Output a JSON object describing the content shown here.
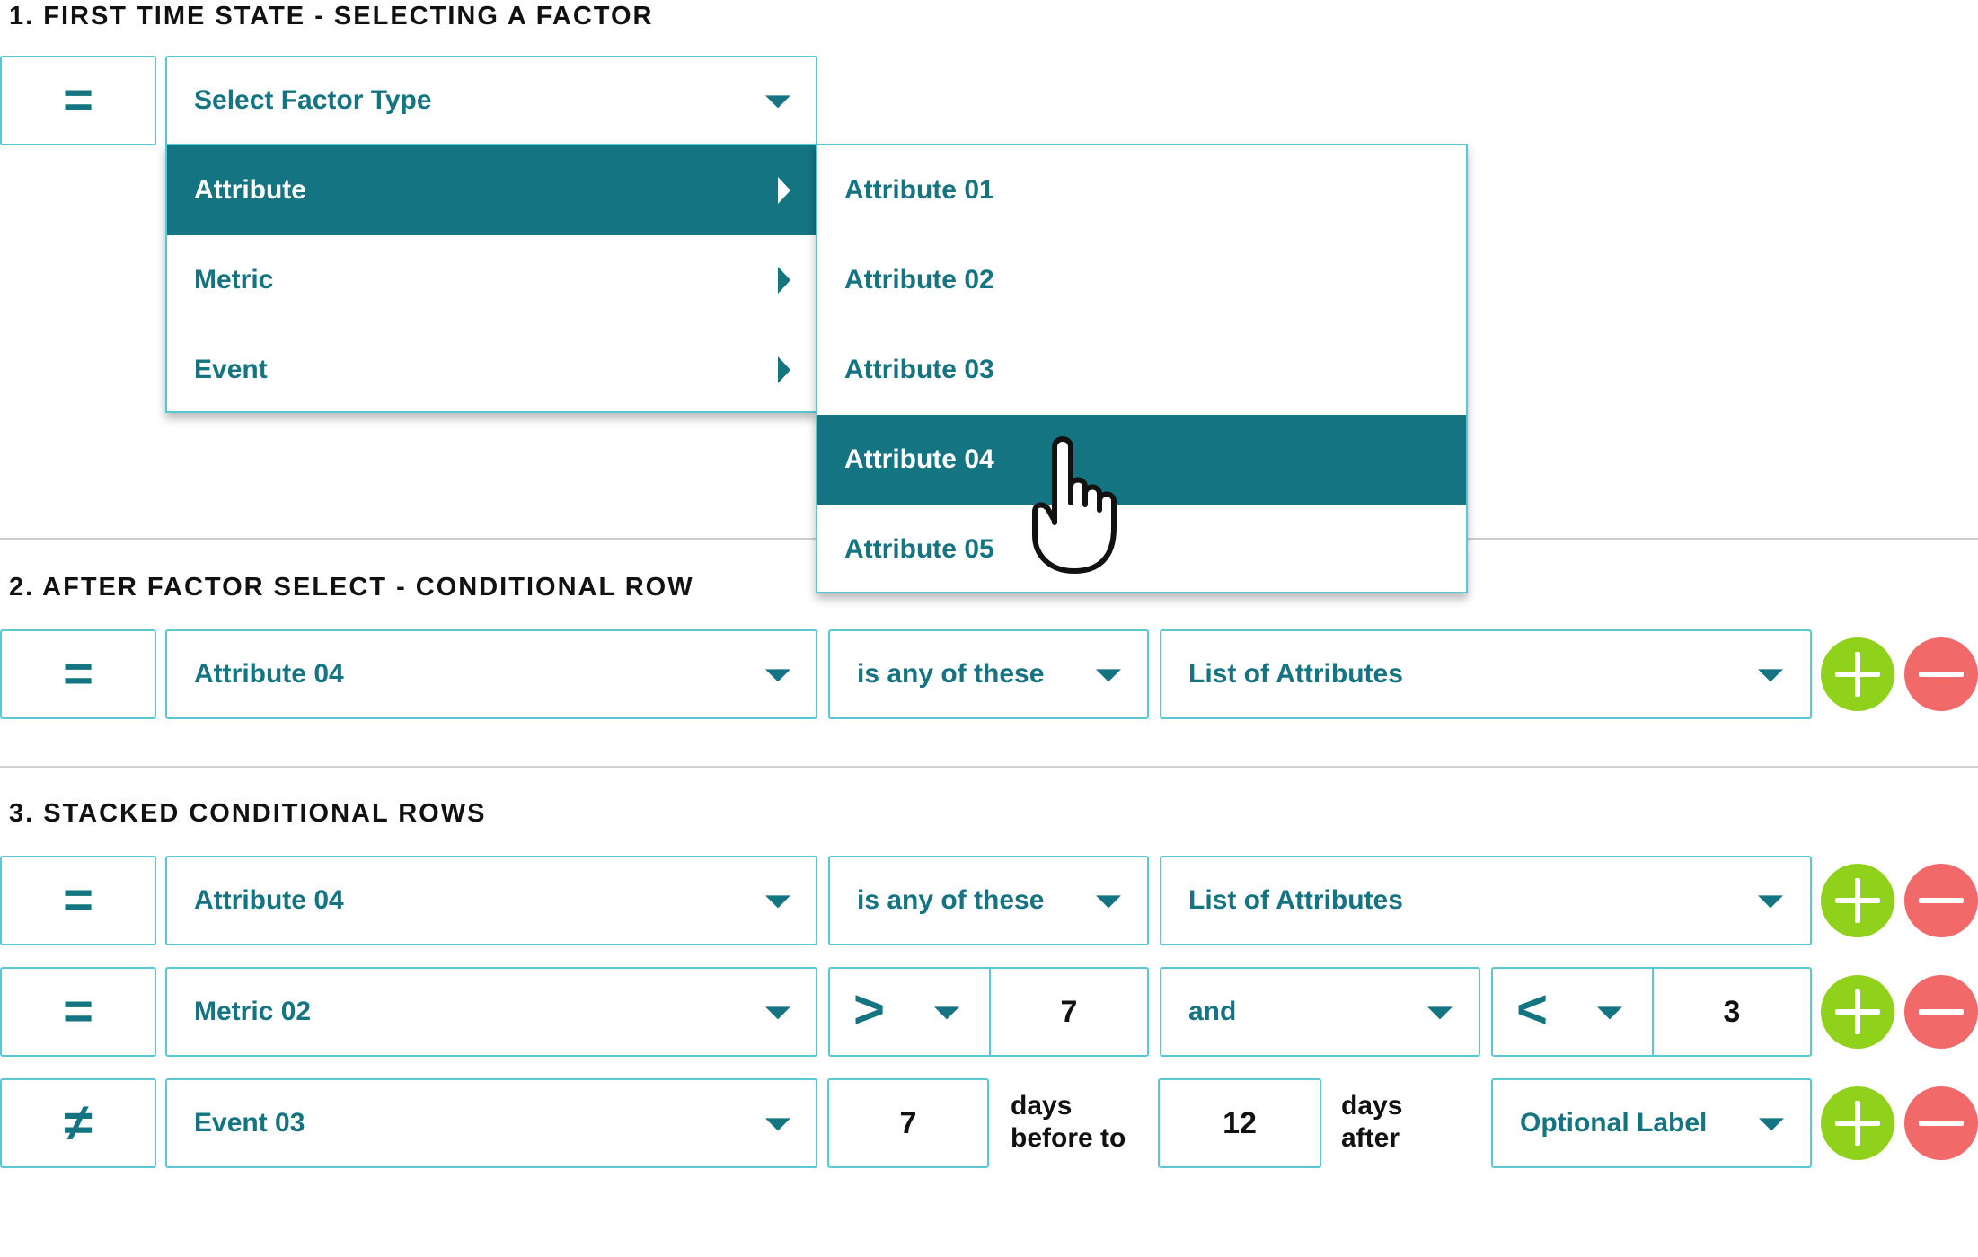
{
  "sections": {
    "s1": "1. FIRST TIME STATE - SELECTING A FACTOR",
    "s2": "2. AFTER FACTOR SELECT - CONDITIONAL ROW",
    "s3": "3. STACKED CONDITIONAL ROWS"
  },
  "first_state": {
    "operator": "=",
    "factor_placeholder": "Select Factor Type",
    "factor_menu": [
      "Attribute",
      "Metric",
      "Event"
    ],
    "submenu": [
      "Attribute 01",
      "Attribute 02",
      "Attribute 03",
      "Attribute 04",
      "Attribute 05"
    ],
    "highlighted_factor": "Attribute",
    "highlighted_attribute": "Attribute 04"
  },
  "row2": {
    "operator": "=",
    "factor": "Attribute 04",
    "condition": "is any of these",
    "value": "List of Attributes"
  },
  "stacked": {
    "row1": {
      "operator": "=",
      "factor": "Attribute 04",
      "condition": "is any of these",
      "value": "List of Attributes"
    },
    "row2": {
      "operator": "=",
      "factor": "Metric 02",
      "cmp1": ">",
      "val1": "7",
      "joiner": "and",
      "cmp2": "<",
      "val2": "3"
    },
    "row3": {
      "operator": "≠",
      "factor": "Event 03",
      "before_value": "7",
      "before_text_1": "days",
      "before_text_2": "before to",
      "after_value": "12",
      "after_text_1": "days",
      "after_text_2": "after",
      "label": "Optional Label"
    }
  },
  "colors": {
    "teal": "#157482",
    "border": "#58c9d2",
    "add": "#8fd11b",
    "remove": "#f2696a"
  },
  "icons": {
    "add": "plus-icon",
    "remove": "minus-icon",
    "cursor": "hand-pointer-icon",
    "dropdown": "caret-down-icon",
    "submenu": "caret-right-icon"
  }
}
